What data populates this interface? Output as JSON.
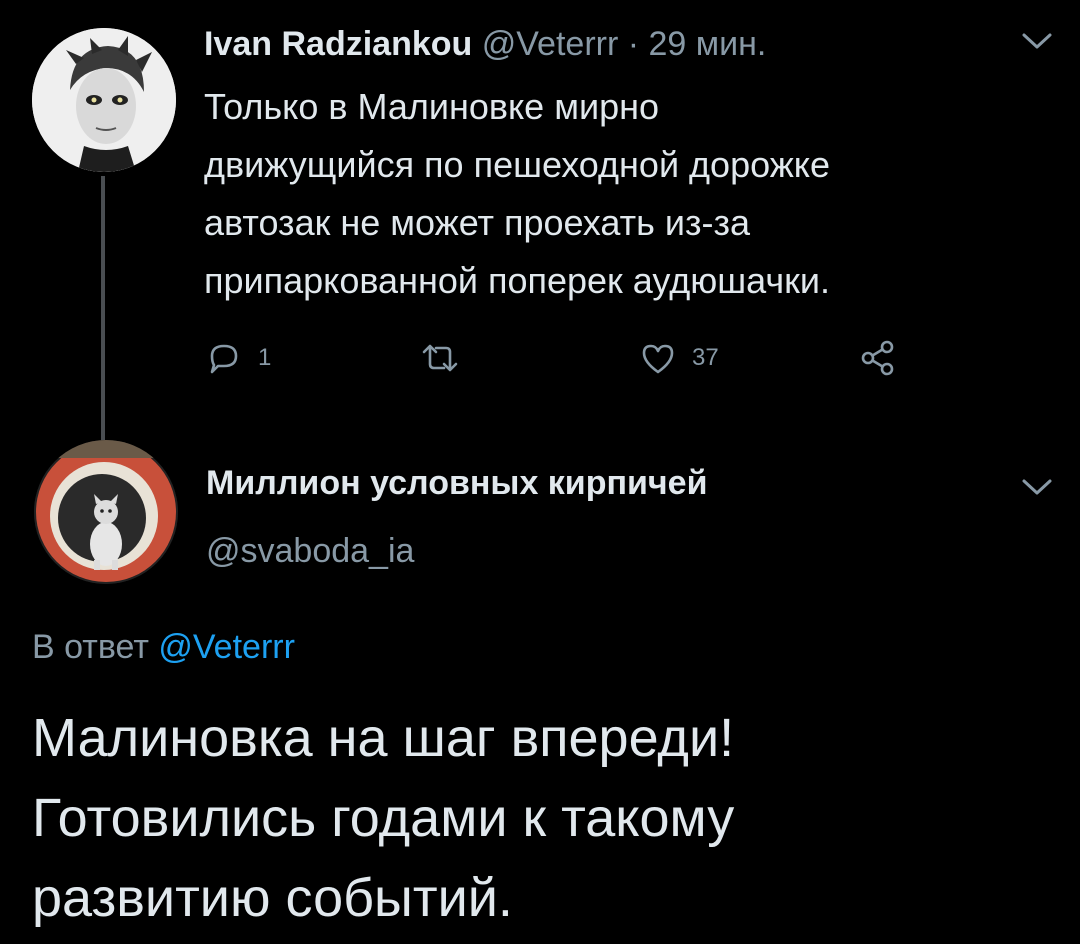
{
  "parent_tweet": {
    "author_name": "Ivan Radziankou",
    "author_handle": "@Veterrr",
    "separator": " · ",
    "time": "29 мин.",
    "text": "Только в Малиновке мирно\nдвижущийся по пешеходной дорожке\nавтозак не может проехать из-за\nприпаркованной поперек аудюшачки.",
    "actions": {
      "reply_count": "1",
      "retweet_count": "",
      "like_count": "37"
    }
  },
  "reply_tweet": {
    "author_name": "Миллион условных кирпичей",
    "author_handle": "@svaboda_ia",
    "reply_prefix": "В ответ",
    "reply_to_handle": "@Veterrr",
    "text": "Малиновка на шаг впереди!\nГотовились годами к такому\nразвитию событий."
  },
  "icons": {
    "reply": "comment-bubble-icon",
    "retweet": "retweet-icon",
    "like": "heart-icon",
    "share": "share-icon",
    "menu": "chevron-down-icon"
  },
  "colors": {
    "background": "#000000",
    "text_primary": "#e1e8ed",
    "text_secondary": "#8899a6",
    "link": "#1da1f2",
    "thread_line": "#4a4e52"
  }
}
